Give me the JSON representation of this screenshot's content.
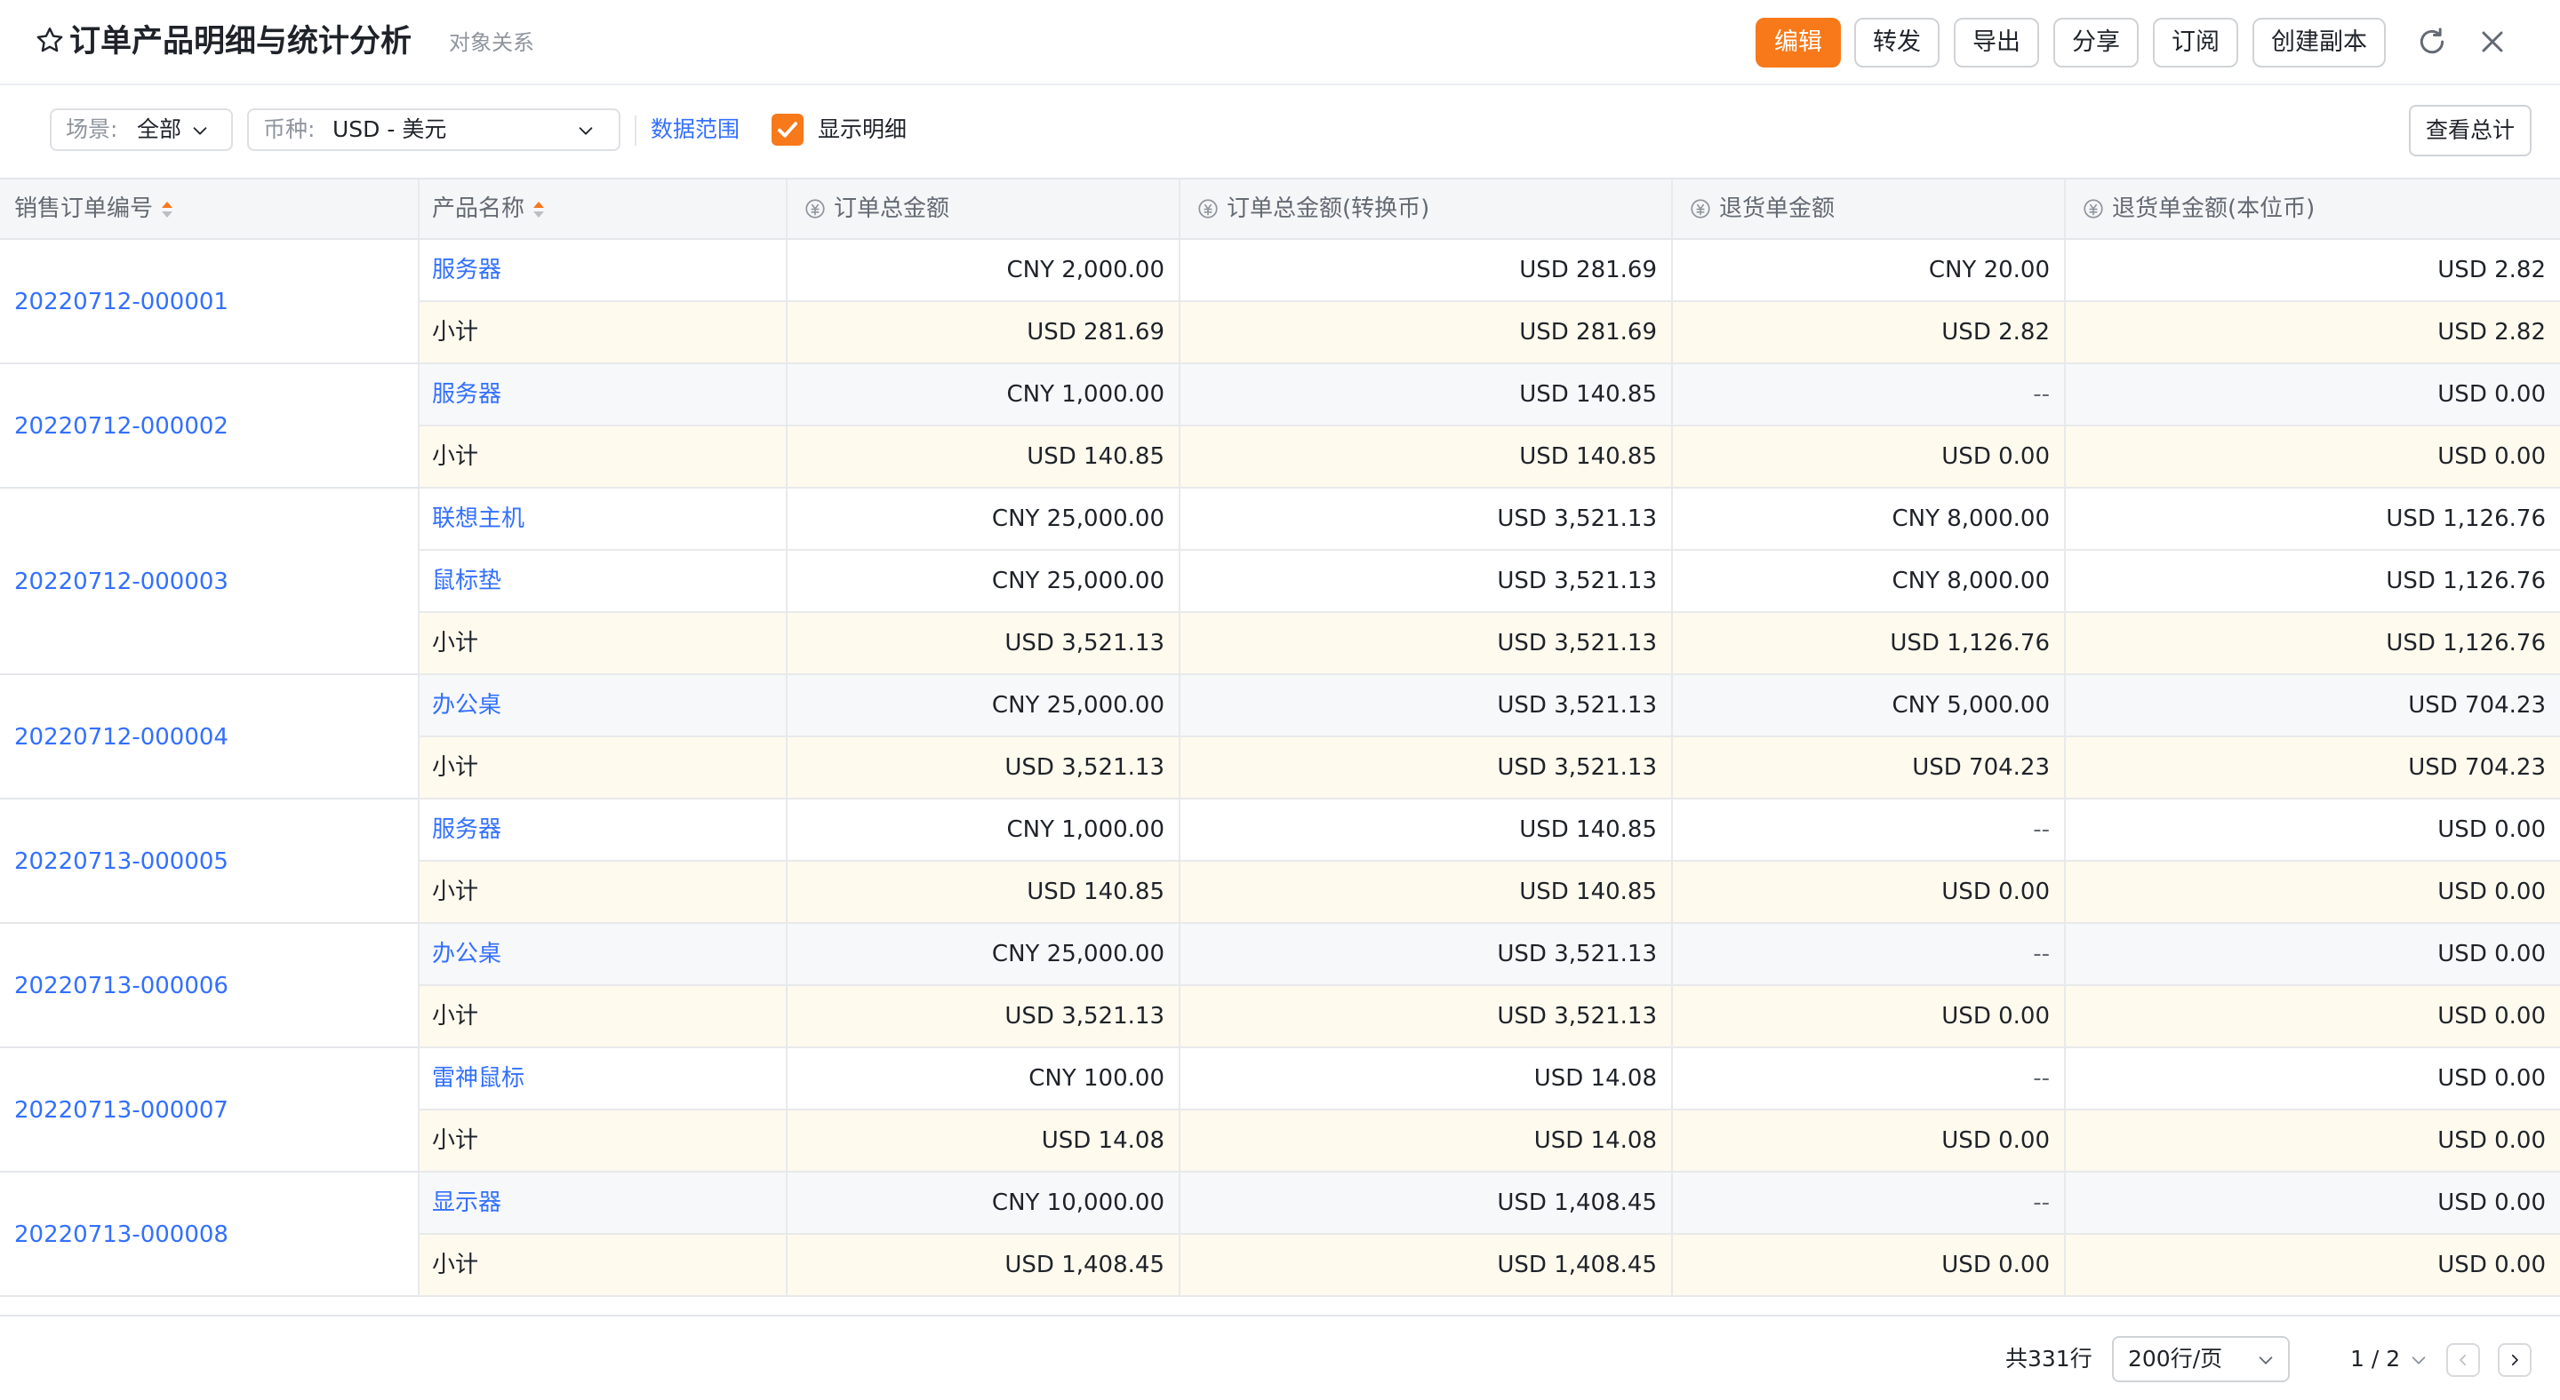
{
  "header": {
    "title": "订单产品明细与统计分析",
    "subtitle": "对象关系",
    "buttons": {
      "edit": "编辑",
      "forward": "转发",
      "export": "导出",
      "share": "分享",
      "subscribe": "订阅",
      "duplicate": "创建副本"
    }
  },
  "toolbar": {
    "scene_label": "场景:",
    "scene_value": "全部",
    "currency_label": "币种:",
    "currency_value": "USD - 美元",
    "data_range": "数据范围",
    "show_detail": "显示明细",
    "show_detail_checked": true,
    "view_total": "查看总计"
  },
  "table": {
    "columns": [
      "销售订单编号",
      "产品名称",
      "订单总金额",
      "订单总金额(转换币)",
      "退货单金额",
      "退货单金额(本位币)"
    ],
    "subtotal_label": "小计",
    "orders": [
      {
        "id": "20220712-000001",
        "rows": [
          [
            "服务器",
            "CNY 2,000.00",
            "USD 281.69",
            "CNY 20.00",
            "USD 2.82"
          ],
          [
            "小计",
            "USD 281.69",
            "USD 281.69",
            "USD 2.82",
            "USD 2.82"
          ]
        ]
      },
      {
        "id": "20220712-000002",
        "rows": [
          [
            "服务器",
            "CNY 1,000.00",
            "USD 140.85",
            "--",
            "USD 0.00"
          ],
          [
            "小计",
            "USD 140.85",
            "USD 140.85",
            "USD 0.00",
            "USD 0.00"
          ]
        ]
      },
      {
        "id": "20220712-000003",
        "rows": [
          [
            "联想主机",
            "CNY 25,000.00",
            "USD 3,521.13",
            "CNY 8,000.00",
            "USD 1,126.76"
          ],
          [
            "鼠标垫",
            "CNY 25,000.00",
            "USD 3,521.13",
            "CNY 8,000.00",
            "USD 1,126.76"
          ],
          [
            "小计",
            "USD 3,521.13",
            "USD 3,521.13",
            "USD 1,126.76",
            "USD 1,126.76"
          ]
        ]
      },
      {
        "id": "20220712-000004",
        "rows": [
          [
            "办公桌",
            "CNY 25,000.00",
            "USD 3,521.13",
            "CNY 5,000.00",
            "USD 704.23"
          ],
          [
            "小计",
            "USD 3,521.13",
            "USD 3,521.13",
            "USD 704.23",
            "USD 704.23"
          ]
        ]
      },
      {
        "id": "20220713-000005",
        "rows": [
          [
            "服务器",
            "CNY 1,000.00",
            "USD 140.85",
            "--",
            "USD 0.00"
          ],
          [
            "小计",
            "USD 140.85",
            "USD 140.85",
            "USD 0.00",
            "USD 0.00"
          ]
        ]
      },
      {
        "id": "20220713-000006",
        "rows": [
          [
            "办公桌",
            "CNY 25,000.00",
            "USD 3,521.13",
            "--",
            "USD 0.00"
          ],
          [
            "小计",
            "USD 3,521.13",
            "USD 3,521.13",
            "USD 0.00",
            "USD 0.00"
          ]
        ]
      },
      {
        "id": "20220713-000007",
        "rows": [
          [
            "雷神鼠标",
            "CNY 100.00",
            "USD 14.08",
            "--",
            "USD 0.00"
          ],
          [
            "小计",
            "USD 14.08",
            "USD 14.08",
            "USD 0.00",
            "USD 0.00"
          ]
        ]
      },
      {
        "id": "20220713-000008",
        "rows": [
          [
            "显示器",
            "CNY 10,000.00",
            "USD 1,408.45",
            "--",
            "USD 0.00"
          ],
          [
            "小计",
            "USD 1,408.45",
            "USD 1,408.45",
            "USD 0.00",
            "USD 0.00"
          ]
        ]
      }
    ]
  },
  "footer": {
    "total_rows": "共331行",
    "page_size": "200行/页",
    "page_indicator": "1 / 2"
  },
  "colors": {
    "accent": "#f7791a",
    "link": "#3370ff",
    "subtotal_bg": "#fefaee",
    "header_bg": "#f5f6f7"
  },
  "icons": [
    "star-icon",
    "refresh-icon",
    "close-icon",
    "chevron-down-icon",
    "check-icon",
    "currency-icon",
    "sort-icon",
    "chevron-left-icon",
    "chevron-right-icon"
  ]
}
